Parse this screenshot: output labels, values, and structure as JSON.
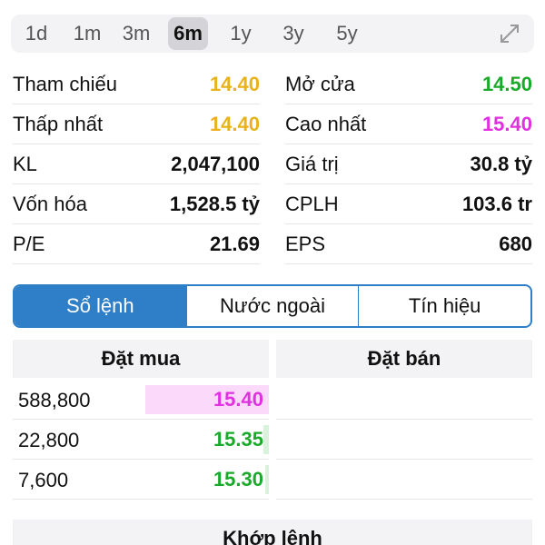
{
  "range": {
    "options": [
      "1d",
      "1m",
      "3m",
      "6m",
      "1y",
      "3y",
      "5y"
    ],
    "selected": "6m"
  },
  "colors": {
    "reference": "#e8b21c",
    "up": "#1aaa2a",
    "ceiling": "#e030e0",
    "accent": "#2e7fc7"
  },
  "stats": {
    "left": [
      {
        "label": "Tham chiếu",
        "value": "14.40",
        "color": "#e8b21c"
      },
      {
        "label": "Thấp nhất",
        "value": "14.40",
        "color": "#e8b21c"
      },
      {
        "label": "KL",
        "value": "2,047,100",
        "color": "#111111"
      },
      {
        "label": "Vốn hóa",
        "value": "1,528.5 tỷ",
        "color": "#111111"
      },
      {
        "label": "P/E",
        "value": "21.69",
        "color": "#111111"
      }
    ],
    "right": [
      {
        "label": "Mở cửa",
        "value": "14.50",
        "color": "#1aaa2a"
      },
      {
        "label": "Cao nhất",
        "value": "15.40",
        "color": "#e030e0"
      },
      {
        "label": "Giá trị",
        "value": "30.8 tỷ",
        "color": "#111111"
      },
      {
        "label": "CPLH",
        "value": "103.6 tr",
        "color": "#111111"
      },
      {
        "label": "EPS",
        "value": "680",
        "color": "#111111"
      }
    ]
  },
  "tabs": {
    "items": [
      "Sổ lệnh",
      "Nước ngoài",
      "Tín hiệu"
    ],
    "selected": "Sổ lệnh"
  },
  "orderbook": {
    "buy_title": "Đặt mua",
    "sell_title": "Đặt bán",
    "buy": [
      {
        "volume": "588,800",
        "price": "15.40",
        "color": "#e030e0",
        "bar_color": "#fbd9fb",
        "depth": 0.97
      },
      {
        "volume": "22,800",
        "price": "15.35",
        "color": "#1aaa2a",
        "bar_color": "#d9f2dc",
        "depth": 0.04
      },
      {
        "volume": "7,600",
        "price": "15.30",
        "color": "#1aaa2a",
        "bar_color": "#d9f2dc",
        "depth": 0.01
      }
    ]
  },
  "match": {
    "title": "Khớp lệnh"
  }
}
